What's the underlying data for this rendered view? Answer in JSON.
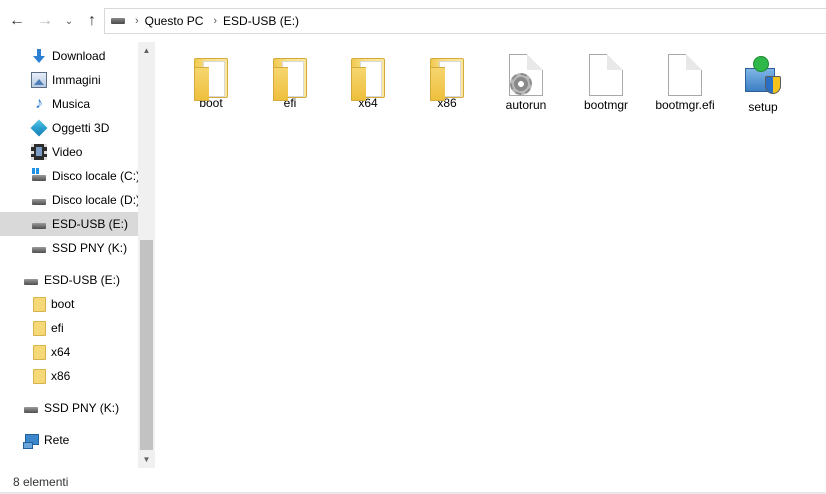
{
  "navigation": {
    "back_icon": "←",
    "forward_icon": "→",
    "recent_icon": "⌄",
    "up_icon": "↑"
  },
  "breadcrumb": {
    "separator": "›",
    "items": [
      "Questo PC",
      "ESD-USB (E:)"
    ]
  },
  "sidebar": {
    "quick_items": [
      {
        "label": "Download",
        "icon": "download-icon"
      },
      {
        "label": "Immagini",
        "icon": "pictures-icon"
      },
      {
        "label": "Musica",
        "icon": "music-icon"
      },
      {
        "label": "Oggetti 3D",
        "icon": "3d-objects-icon"
      },
      {
        "label": "Video",
        "icon": "video-icon"
      },
      {
        "label": "Disco locale (C:)",
        "icon": "windows-drive-icon"
      },
      {
        "label": "Disco locale (D:)",
        "icon": "drive-icon"
      },
      {
        "label": "ESD-USB (E:)",
        "icon": "usb-drive-icon",
        "selected": true
      },
      {
        "label": "SSD PNY (K:)",
        "icon": "drive-icon"
      }
    ],
    "usb_root": {
      "label": "ESD-USB (E:)",
      "icon": "usb-drive-icon"
    },
    "usb_folders": [
      "boot",
      "efi",
      "x64",
      "x86"
    ],
    "ssd_root": {
      "label": "SSD PNY (K:)",
      "icon": "drive-icon"
    },
    "network": {
      "label": "Rete",
      "icon": "network-icon"
    }
  },
  "files": [
    {
      "name": "boot",
      "type": "folder"
    },
    {
      "name": "efi",
      "type": "folder"
    },
    {
      "name": "x64",
      "type": "folder"
    },
    {
      "name": "x86",
      "type": "folder"
    },
    {
      "name": "autorun",
      "type": "settings-file"
    },
    {
      "name": "bootmgr",
      "type": "file"
    },
    {
      "name": "bootmgr.efi",
      "type": "file"
    },
    {
      "name": "setup",
      "type": "setup-exe"
    }
  ],
  "statusbar": {
    "item_count": "8 elementi"
  },
  "colors": {
    "selection": "#d9d9d9",
    "folder": "#f5d877",
    "accent_blue": "#2d7fd3"
  }
}
